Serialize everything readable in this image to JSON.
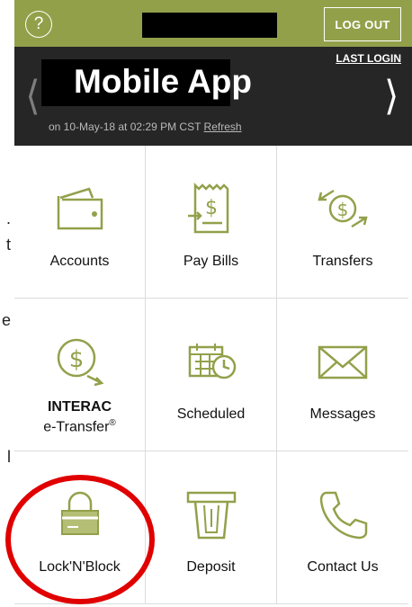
{
  "background_fragments": ".",
  "background_fragments_2": "t",
  "background_fragments_3": "e",
  "background_fragments_4": "l",
  "header": {
    "help_icon": "question-mark",
    "logout_label": "LOG OUT"
  },
  "banner": {
    "last_login_label": "LAST LOGIN",
    "title": "Mobile App",
    "updated_text": "on 10-May-18 at 02:29 PM CST",
    "refresh_label": "Refresh"
  },
  "menu": {
    "accounts": "Accounts",
    "pay_bills": "Pay Bills",
    "transfers": "Transfers",
    "interac_line1": "INTERAC",
    "interac_line2": "e-Transfer",
    "interac_reg": "®",
    "scheduled": "Scheduled",
    "messages": "Messages",
    "lock_n_block": "Lock'N'Block",
    "deposit": "Deposit",
    "contact_us": "Contact Us"
  },
  "colors": {
    "accent": "#93a04a",
    "banner_bg": "#262626",
    "highlight_circle": "#e00000"
  }
}
